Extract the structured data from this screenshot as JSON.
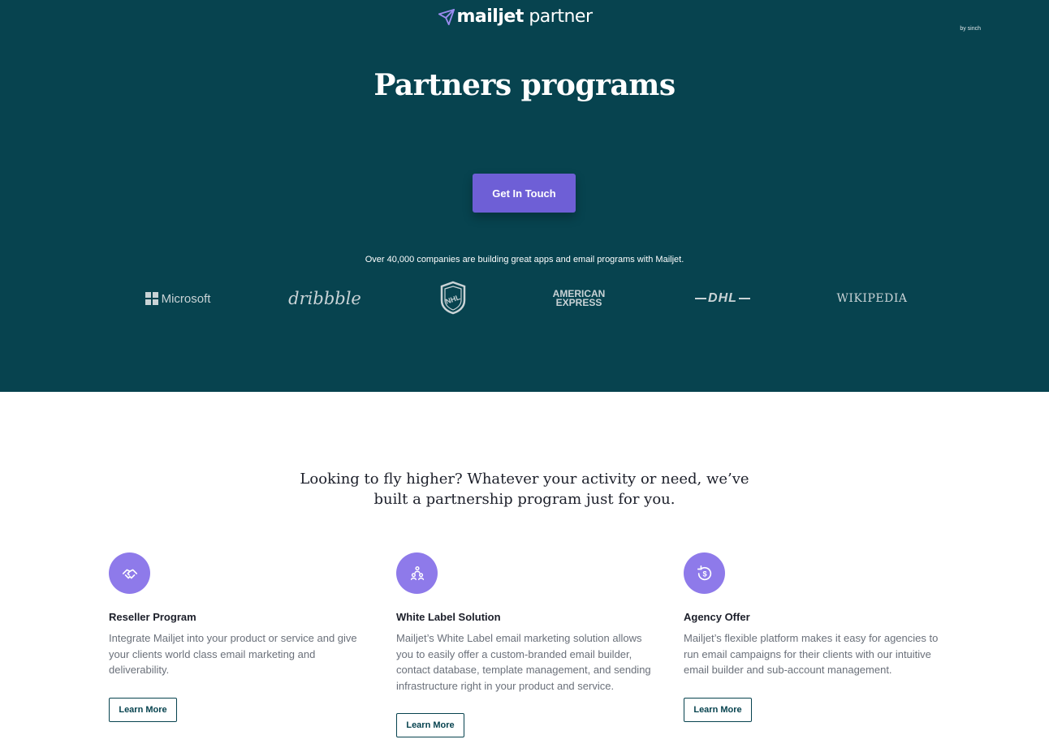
{
  "hero": {
    "logo_brand": "mailjet",
    "logo_suffix": "partner",
    "logo_sub": "by sinch",
    "title": "Partners programs",
    "cta_label": "Get In Touch",
    "tagline": "Over 40,000 companies are building great apps and email programs with Mailjet.",
    "brands": {
      "microsoft": "Microsoft",
      "dribbble": "dribbble",
      "nhl": "NHL",
      "amex_line1": "AMERICAN",
      "amex_line2": "EXPRESS",
      "dhl": "DHL",
      "wikipedia": "WIKIPEDIA"
    }
  },
  "section": {
    "intro": "Looking to fly higher? Whatever your activity or need, we’ve built a partnership program just for you."
  },
  "cards": [
    {
      "icon": "handshake-icon",
      "title": "Reseller Program",
      "description": "Integrate Mailjet into your product or service and give your clients world class email marketing and deliverability.",
      "button": "Learn More"
    },
    {
      "icon": "people-group-icon",
      "title": "White Label Solution",
      "description": "Mailjet’s White Label email marketing solution allows you to easily offer a custom-branded email builder, contact database, template management, and sending infrastructure right in your product and service.",
      "button": "Learn More"
    },
    {
      "icon": "dollar-refresh-icon",
      "title": "Agency Offer",
      "description": "Mailjet’s flexible platform makes it easy for agencies to run email campaigns for their clients with our intuitive email builder and sub-account management.",
      "button": "Learn More"
    }
  ],
  "colors": {
    "hero_bg": "#07434f",
    "accent": "#6e5fd6",
    "icon_bg": "#8e7aea"
  }
}
